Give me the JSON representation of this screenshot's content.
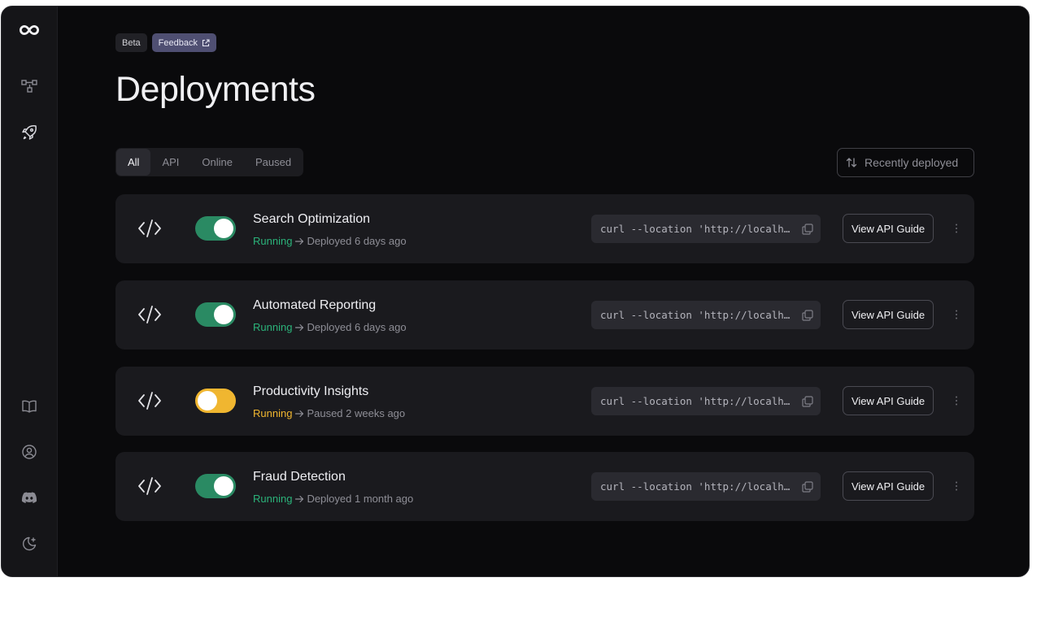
{
  "badges": {
    "beta": "Beta",
    "feedback": "Feedback"
  },
  "page_title": "Deployments",
  "tabs": [
    {
      "label": "All",
      "active": true
    },
    {
      "label": "API",
      "active": false
    },
    {
      "label": "Online",
      "active": false
    },
    {
      "label": "Paused",
      "active": false
    }
  ],
  "sort": {
    "label": "Recently deployed",
    "icon": "sort-arrows-icon"
  },
  "sidebar": {
    "top_icons": [
      "logo-infinity-icon",
      "workflow-icon",
      "rocket-icon"
    ],
    "bottom_icons": [
      "book-icon",
      "user-circle-icon",
      "discord-icon",
      "moon-icon"
    ]
  },
  "deployments": [
    {
      "title": "Search Optimization",
      "state": "Running",
      "state_color": "#2bb37a",
      "toggle": "on",
      "detail": "Deployed 6 days ago",
      "curl": "curl --location 'http://localhost",
      "api_button": "View API Guide"
    },
    {
      "title": "Automated Reporting",
      "state": "Running",
      "state_color": "#2bb37a",
      "toggle": "on",
      "detail": "Deployed 6 days ago",
      "curl": "curl --location 'http://localhost",
      "api_button": "View API Guide"
    },
    {
      "title": "Productivity Insights",
      "state": "Running",
      "state_color": "#f0b630",
      "toggle": "paused",
      "detail": "Paused 2 weeks ago",
      "curl": "curl --location 'http://localhost",
      "api_button": "View API Guide"
    },
    {
      "title": "Fraud Detection",
      "state": "Running",
      "state_color": "#2bb37a",
      "toggle": "on",
      "detail": "Deployed 1 month ago",
      "curl": "curl --location 'http://localhost",
      "api_button": "View API Guide"
    }
  ],
  "colors": {
    "accent_green": "#2a8a63",
    "accent_yellow": "#f0b630",
    "feedback_badge": "#4f4f72"
  }
}
